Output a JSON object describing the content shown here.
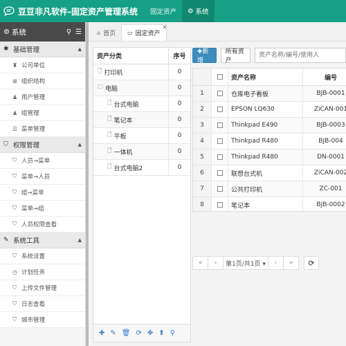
{
  "app": {
    "title": "豆豆非凡软件-固定资产管理系统"
  },
  "topnav": [
    {
      "label": "固定资产",
      "icon": ""
    },
    {
      "label": "系统",
      "icon": "⚙"
    }
  ],
  "sidebar": {
    "title": "系统",
    "sections": [
      {
        "label": "基础管理",
        "icon": "✱",
        "items": [
          {
            "label": "公司单位",
            "icon": "♜"
          },
          {
            "label": "组织结构",
            "icon": "⊞"
          },
          {
            "label": "用户管理",
            "icon": "♟"
          },
          {
            "label": "组管理",
            "icon": "♟"
          },
          {
            "label": "菜单管理",
            "icon": "☰"
          }
        ]
      },
      {
        "label": "权限管理",
        "icon": "⛉",
        "items": [
          {
            "label": "人员→菜单",
            "icon": "⛉"
          },
          {
            "label": "菜单→人员",
            "icon": "⛉"
          },
          {
            "label": "组→菜单",
            "icon": "⛉"
          },
          {
            "label": "菜单→组",
            "icon": "⛉"
          },
          {
            "label": "人员权限查看",
            "icon": "⛉"
          }
        ]
      },
      {
        "label": "系统工具",
        "icon": "✎",
        "items": [
          {
            "label": "系统设置",
            "icon": "⛉"
          },
          {
            "label": "计划任务",
            "icon": "◷"
          },
          {
            "label": "上传文件管理",
            "icon": "⛉"
          },
          {
            "label": "日志查看",
            "icon": "⛉"
          },
          {
            "label": "城市管理",
            "icon": "⛉"
          }
        ]
      }
    ]
  },
  "tabs": [
    {
      "label": "首页",
      "icon": "⌂"
    },
    {
      "label": "固定资产",
      "icon": "▭",
      "close": "×"
    }
  ],
  "category": {
    "headers": [
      "资产分类",
      "序号"
    ],
    "rows": [
      {
        "name": "打印机",
        "icon": "🗋",
        "seq": "0",
        "indent": 0
      },
      {
        "name": "电脑",
        "icon": "🗀",
        "seq": "0",
        "indent": 0
      },
      {
        "name": "台式电脑",
        "icon": "🗋",
        "seq": "0",
        "indent": 1
      },
      {
        "name": "笔记本",
        "icon": "🗋",
        "seq": "0",
        "indent": 1
      },
      {
        "name": "平板",
        "icon": "🗋",
        "seq": "0",
        "indent": 1
      },
      {
        "name": "一体机",
        "icon": "🗋",
        "seq": "0",
        "indent": 1
      },
      {
        "name": "台式电脑2",
        "icon": "🗋",
        "seq": "0",
        "indent": 1
      }
    ],
    "tools": [
      {
        "name": "add",
        "glyph": "✚"
      },
      {
        "name": "edit",
        "glyph": "✎"
      },
      {
        "name": "delete",
        "glyph": "🗑"
      },
      {
        "name": "refresh",
        "glyph": "⟳"
      },
      {
        "name": "move",
        "glyph": "✥"
      },
      {
        "name": "up",
        "glyph": "⬆"
      },
      {
        "name": "search",
        "glyph": "⚲"
      }
    ]
  },
  "toolbar": {
    "new_label": "✚新增",
    "all_label": "所有资产",
    "search_placeholder": "资产名称/编号/使用人"
  },
  "assets": {
    "headers": {
      "name": "资产名称",
      "code": "编号"
    },
    "rows": [
      {
        "n": "1",
        "name": "仓库电子看板",
        "code": "BJB-0001"
      },
      {
        "n": "2",
        "name": "EPSON LQ630",
        "code": "ZiCAN-001"
      },
      {
        "n": "3",
        "name": "Thinkpad E490",
        "code": "BJB-0003"
      },
      {
        "n": "4",
        "name": "Thinkpad R480",
        "code": "BJB-004"
      },
      {
        "n": "5",
        "name": "Thinkpad R480",
        "code": "DN-0001"
      },
      {
        "n": "6",
        "name": "联想台式机",
        "code": "ZiCAN-002"
      },
      {
        "n": "7",
        "name": "公共打印机",
        "code": "ZC-001"
      },
      {
        "n": "8",
        "name": "笔记本",
        "code": "BJB-0002"
      }
    ]
  },
  "pager": {
    "first": "«",
    "prev": "‹",
    "info": "第1页/共1页 ▾",
    "next": "›",
    "last": "»",
    "refresh": "⟳"
  }
}
